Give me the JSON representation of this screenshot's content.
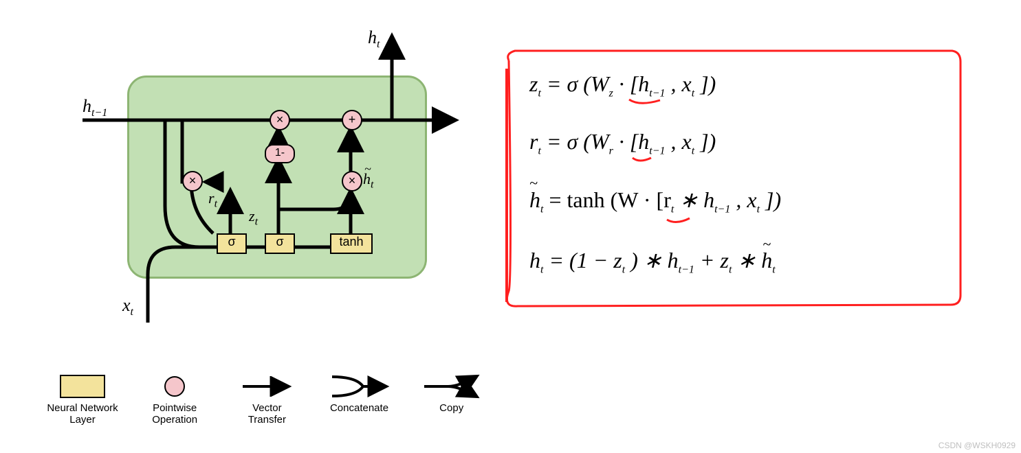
{
  "cell": {
    "input_prev_h": "h",
    "input_prev_h_sub": "t−1",
    "output_h": "h",
    "output_h_sub": "t",
    "input_x": "x",
    "input_x_sub": "t",
    "gate_sigma1": "σ",
    "gate_sigma2": "σ",
    "gate_tanh": "tanh",
    "r_label": "r",
    "r_sub": "t",
    "z_label": "z",
    "z_sub": "t",
    "htilde_over": "~",
    "htilde": "h",
    "htilde_sub": "t",
    "op_mul": "×",
    "op_add": "+",
    "one_minus": "1-"
  },
  "equations": {
    "eq1": {
      "lhs": "z",
      "lhs_sub": "t",
      "rhs": "= σ (W",
      "W_sub": "z",
      "tail": " · [h",
      "h_sub": "t−1",
      "tail2": ", x",
      "x_sub": "t",
      "close": "])"
    },
    "eq2": {
      "lhs": "r",
      "lhs_sub": "t",
      "rhs": "= σ (W",
      "W_sub": "r",
      "tail": " · [h",
      "h_sub": "t−1",
      "tail2": ", x",
      "x_sub": "t",
      "close": "])"
    },
    "eq3": {
      "tilde": "~",
      "lhs": "h",
      "lhs_sub": "t",
      "rhs": "= tanh (W · [r",
      "r_sub": "t",
      "mid": " ∗ h",
      "h_sub": "t−1",
      "tail": ", x",
      "x_sub": "t",
      "close": "])"
    },
    "eq4": {
      "lhs": "h",
      "lhs_sub": "t",
      "rhs": "= (1 − z",
      "z_sub": "t",
      "mid": ") ∗ h",
      "h_sub": "t−1",
      "plus": " + z",
      "z2_sub": "t",
      "star": " ∗ ",
      "tilde": "~",
      "h2": "h",
      "h2_sub": "t"
    }
  },
  "legend": {
    "layer": "Neural Network\nLayer",
    "pointwise": "Pointwise\nOperation",
    "vector": "Vector\nTransfer",
    "concat": "Concatenate",
    "copy": "Copy"
  },
  "watermark": "CSDN @WSKH0929"
}
